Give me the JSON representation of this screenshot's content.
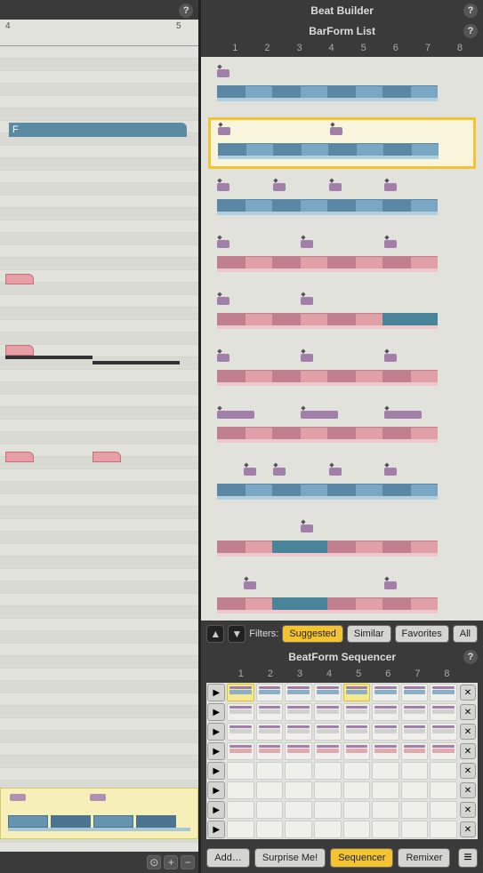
{
  "header": {
    "title": "Beat Builder"
  },
  "barform_list": {
    "title": "BarForm List",
    "columns": [
      "1",
      "2",
      "3",
      "4",
      "5",
      "6",
      "7",
      "8"
    ],
    "selected_index": 1,
    "items_count": 11
  },
  "piano_roll": {
    "note_label": "F",
    "ruler_marks": [
      "4",
      "5"
    ],
    "red_notes_y": [
      295,
      375,
      380,
      495
    ]
  },
  "filters": {
    "label": "Filters:",
    "buttons": [
      {
        "label": "Suggested",
        "active": true
      },
      {
        "label": "Similar",
        "active": false
      },
      {
        "label": "Favorites",
        "active": false
      },
      {
        "label": "All",
        "active": false
      }
    ]
  },
  "sequencer": {
    "title": "BeatForm Sequencer",
    "columns": [
      "1",
      "2",
      "3",
      "4",
      "5",
      "6",
      "7",
      "8"
    ],
    "rows": 8,
    "highlighted_cols": [
      0,
      4
    ]
  },
  "bottom": {
    "buttons": [
      {
        "label": "Add…",
        "active": false
      },
      {
        "label": "Surprise Me!",
        "active": false
      },
      {
        "label": "Sequencer",
        "active": true
      },
      {
        "label": "Remixer",
        "active": false
      }
    ]
  },
  "zoom": {
    "buttons": [
      "⊙",
      "+",
      "−"
    ]
  }
}
